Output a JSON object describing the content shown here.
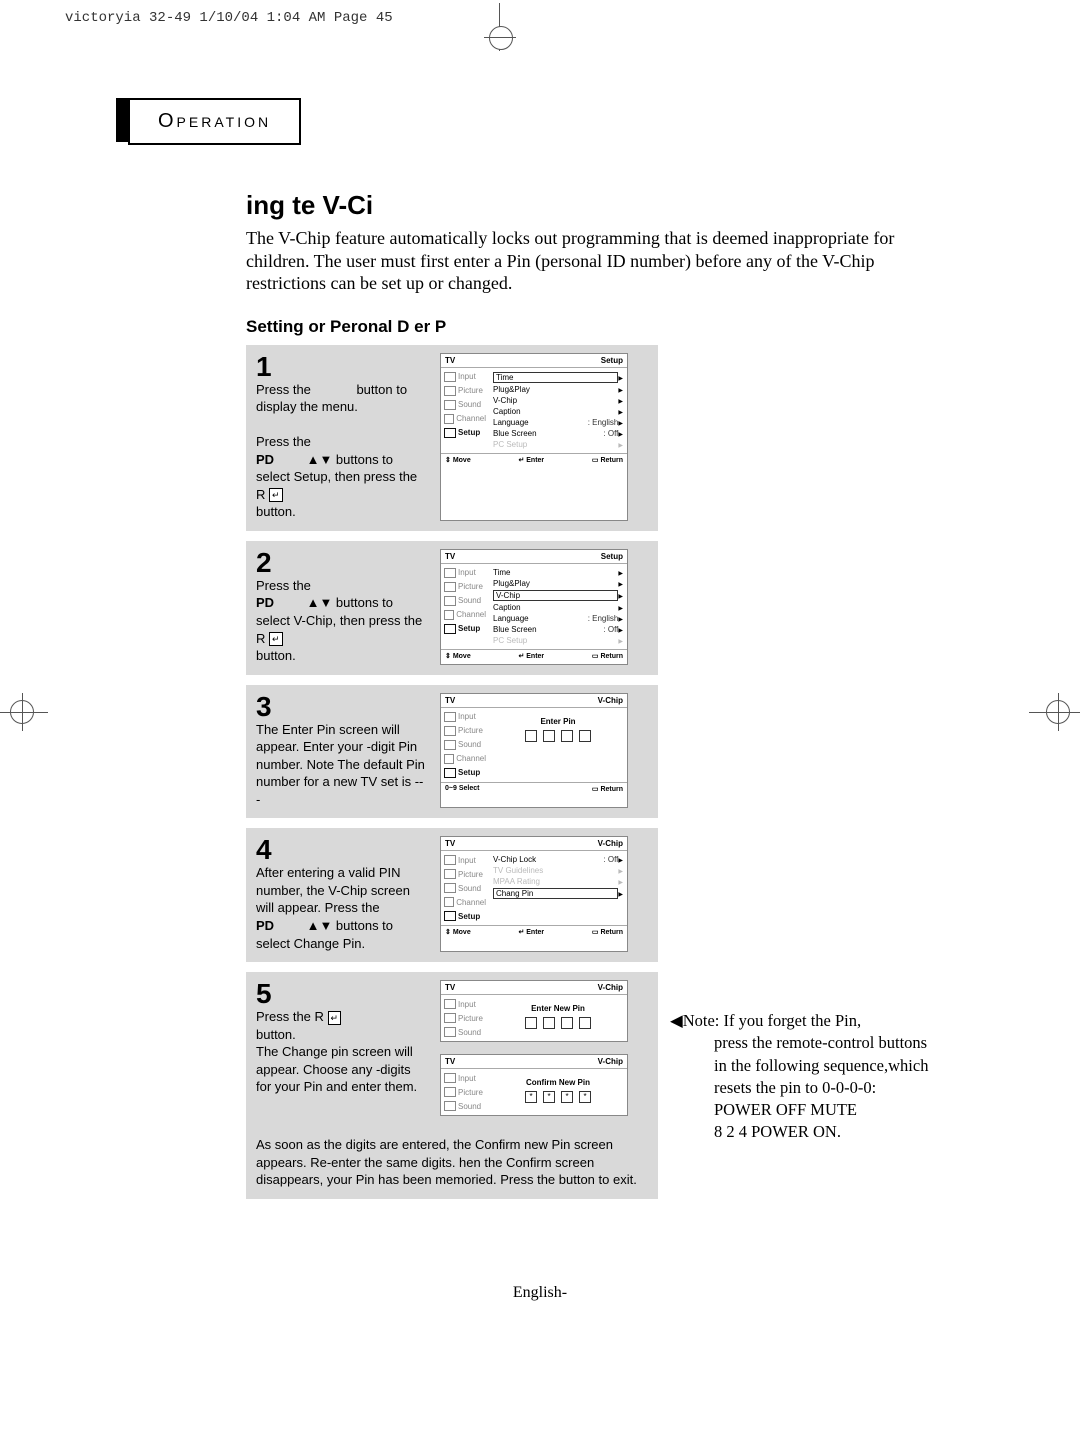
{
  "slug": "victoryia 32-49  1/10/04 1:04 AM  Page 45",
  "operation_label": "Operation",
  "title": "ing te V-Ci",
  "intro": "The V-Chip feature automatically locks out programming that is deemed inappropriate for children. The user must first enter a Pin (personal ID number) before any of the V-Chip restrictions can be set up or changed.",
  "subhead": "Setting  or Peronal D er P",
  "steps": {
    "1": {
      "num": "1",
      "text_a": "Press the",
      "text_b": "button to display the menu.",
      "text_c": "Press the",
      "text_d": "PD",
      "text_e": "▲▼ buttons to select Setup, then press the R",
      "text_f": "button."
    },
    "2": {
      "num": "2",
      "text_a": "Press the",
      "text_b": "PD",
      "text_c": "▲▼ buttons to select V-Chip, then press the R",
      "text_d": "button."
    },
    "3": {
      "num": "3",
      "text": "The Enter Pin screen will appear. Enter your -digit Pin number. Note The default Pin number for a new TV set is  ---"
    },
    "4": {
      "num": "4",
      "text_a": "After entering a valid PIN number, the V-Chip screen will appear. Press the",
      "text_b": "PD",
      "text_c": "▲▼ buttons to select Change Pin."
    },
    "5": {
      "num": "5",
      "text_a": "Press the R",
      "text_b": "button.",
      "text_c": "The Change pin screen will appear. Choose any -digits for your Pin and enter them.",
      "after": "As soon as the  digits are entered, the Confirm new Pin screen appears. Re-enter the same  digits. hen the Confirm screen disappears, your Pin has been memoried. Press the               button to exit."
    }
  },
  "tv": {
    "tv_label": "TV",
    "setup_label": "Setup",
    "vchip_label": "V-Chip",
    "side_items": [
      "Input",
      "Picture",
      "Sound",
      "Channel",
      "Setup"
    ],
    "menu_setup": [
      {
        "label": "Time",
        "val": "",
        "boxed": true
      },
      {
        "label": "Plug&Play",
        "val": ""
      },
      {
        "label": "V-Chip",
        "val": ""
      },
      {
        "label": "Caption",
        "val": ""
      },
      {
        "label": "Language",
        "val": ":  English"
      },
      {
        "label": "Blue Screen",
        "val": ":  Off"
      },
      {
        "label": "PC Setup",
        "val": "",
        "dim": true
      }
    ],
    "menu_setup2_boxed": "V-Chip",
    "enter_pin": "Enter Pin",
    "vchip_menu": [
      {
        "label": "V-Chip Lock",
        "val": ":  Off"
      },
      {
        "label": "TV Guidelines",
        "val": "",
        "dim": true
      },
      {
        "label": "MPAA Rating",
        "val": "",
        "dim": true
      },
      {
        "label": "Chang Pin",
        "val": "",
        "boxed": true
      }
    ],
    "enter_new_pin": "Enter New Pin",
    "confirm_new_pin": "Confirm New Pin",
    "foot_move": "Move",
    "foot_enter": "Enter",
    "foot_return": "Return",
    "foot_select": "0~9  Select"
  },
  "note": {
    "prefix": "Note:",
    "line1": "If you forget the Pin,",
    "body": "press the remote-control buttons in the following sequence,which resets the pin to 0-0-0-0:",
    "line3": "POWER OFF      MUTE",
    "line4": "8      2      4      POWER ON."
  },
  "footer": "English-"
}
